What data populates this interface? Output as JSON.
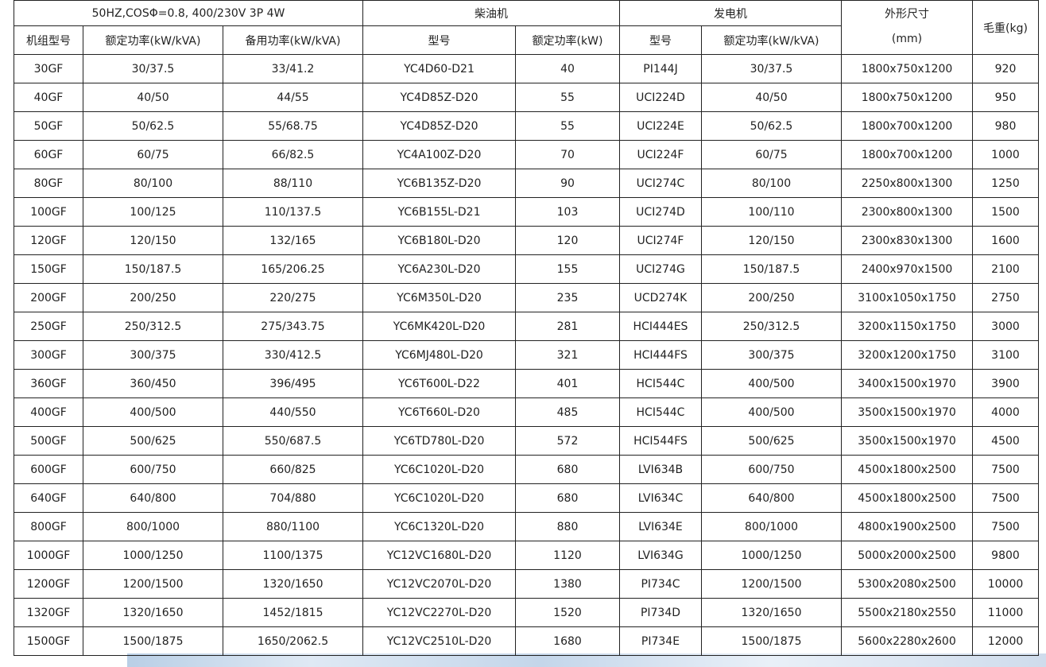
{
  "header": {
    "spec_note": "50HZ,COSΦ=0.8,    400/230V 3P 4W",
    "diesel_group": "柴油机",
    "generator_group": "发电机",
    "dimensions_line1": "外形尺寸",
    "dimensions_line2": "(mm)",
    "weight": "毛重(kg)"
  },
  "columns": {
    "genset_model": "机组型号",
    "rated_power": "额定功率(kW/kVA)",
    "standby_power": "备用功率(kW/kVA)",
    "engine_model": "型号",
    "engine_rated_power": "额定功率(kW)",
    "alternator_model": "型号",
    "alternator_rated_power": "额定功率(kW/kVA)"
  },
  "rows": [
    [
      "30GF",
      "30/37.5",
      "33/41.2",
      "YC4D60-D21",
      "40",
      "PI144J",
      "30/37.5",
      "1800x750x1200",
      "920"
    ],
    [
      "40GF",
      "40/50",
      "44/55",
      "YC4D85Z-D20",
      "55",
      "UCI224D",
      "40/50",
      "1800x750x1200",
      "950"
    ],
    [
      "50GF",
      "50/62.5",
      "55/68.75",
      "YC4D85Z-D20",
      "55",
      "UCI224E",
      "50/62.5",
      "1800x700x1200",
      "980"
    ],
    [
      "60GF",
      "60/75",
      "66/82.5",
      "YC4A100Z-D20",
      "70",
      "UCI224F",
      "60/75",
      "1800x700x1200",
      "1000"
    ],
    [
      "80GF",
      "80/100",
      "88/110",
      "YC6B135Z-D20",
      "90",
      "UCI274C",
      "80/100",
      "2250x800x1300",
      "1250"
    ],
    [
      "100GF",
      "100/125",
      "110/137.5",
      "YC6B155L-D21",
      "103",
      "UCI274D",
      "100/110",
      "2300x800x1300",
      "1500"
    ],
    [
      "120GF",
      "120/150",
      "132/165",
      "YC6B180L-D20",
      "120",
      "UCI274F",
      "120/150",
      "2300x830x1300",
      "1600"
    ],
    [
      "150GF",
      "150/187.5",
      "165/206.25",
      "YC6A230L-D20",
      "155",
      "UCI274G",
      "150/187.5",
      "2400x970x1500",
      "2100"
    ],
    [
      "200GF",
      "200/250",
      "220/275",
      "YC6M350L-D20",
      "235",
      "UCD274K",
      "200/250",
      "3100x1050x1750",
      "2750"
    ],
    [
      "250GF",
      "250/312.5",
      "275/343.75",
      "YC6MK420L-D20",
      "281",
      "HCI444ES",
      "250/312.5",
      "3200x1150x1750",
      "3000"
    ],
    [
      "300GF",
      "300/375",
      "330/412.5",
      "YC6MJ480L-D20",
      "321",
      "HCI444FS",
      "300/375",
      "3200x1200x1750",
      "3100"
    ],
    [
      "360GF",
      "360/450",
      "396/495",
      "YC6T600L-D22",
      "401",
      "HCI544C",
      "400/500",
      "3400x1500x1970",
      "3900"
    ],
    [
      "400GF",
      "400/500",
      "440/550",
      "YC6T660L-D20",
      "485",
      "HCI544C",
      "400/500",
      "3500x1500x1970",
      "4000"
    ],
    [
      "500GF",
      "500/625",
      "550/687.5",
      "YC6TD780L-D20",
      "572",
      "HCI544FS",
      "500/625",
      "3500x1500x1970",
      "4500"
    ],
    [
      "600GF",
      "600/750",
      "660/825",
      "YC6C1020L-D20",
      "680",
      "LVI634B",
      "600/750",
      "4500x1800x2500",
      "7500"
    ],
    [
      "640GF",
      "640/800",
      "704/880",
      "YC6C1020L-D20",
      "680",
      "LVI634C",
      "640/800",
      "4500x1800x2500",
      "7500"
    ],
    [
      "800GF",
      "800/1000",
      "880/1100",
      "YC6C1320L-D20",
      "880",
      "LVI634E",
      "800/1000",
      "4800x1900x2500",
      "7500"
    ],
    [
      "1000GF",
      "1000/1250",
      "1100/1375",
      "YC12VC1680L-D20",
      "1120",
      "LVI634G",
      "1000/1250",
      "5000x2000x2500",
      "9800"
    ],
    [
      "1200GF",
      "1200/1500",
      "1320/1650",
      "YC12VC2070L-D20",
      "1380",
      "PI734C",
      "1200/1500",
      "5300x2080x2500",
      "10000"
    ],
    [
      "1320GF",
      "1320/1650",
      "1452/1815",
      "YC12VC2270L-D20",
      "1520",
      "PI734D",
      "1320/1650",
      "5500x2180x2550",
      "11000"
    ],
    [
      "1500GF",
      "1500/1875",
      "1650/2062.5",
      "YC12VC2510L-D20",
      "1680",
      "PI734E",
      "1500/1875",
      "5600x2280x2600",
      "12000"
    ]
  ]
}
